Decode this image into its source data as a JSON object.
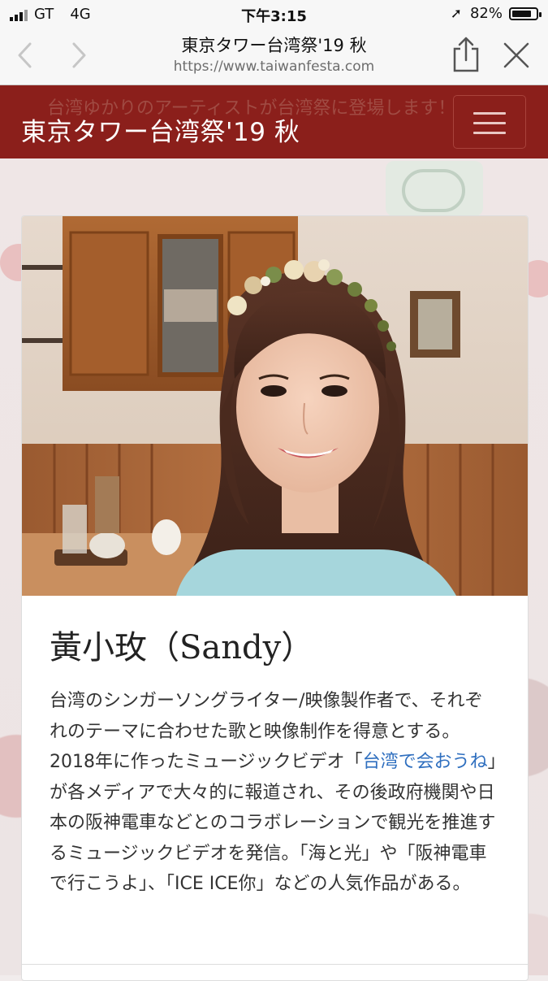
{
  "status_bar": {
    "carrier": "GT",
    "network": "4G",
    "time": "下午3:15",
    "battery": "82%",
    "battery_level": 0.82
  },
  "browser": {
    "page_title": "東京タワー台湾祭'19 秋",
    "url": "https://www.taiwanfesta.com",
    "back_icon": "chevron-left-icon",
    "forward_icon": "chevron-right-icon",
    "share_icon": "share-icon",
    "close_icon": "close-icon"
  },
  "header": {
    "ghost_text": "台湾ゆかりのアーティストが台湾祭に登場します！",
    "brand": "東京タワー台湾祭'19 秋",
    "menu_icon": "hamburger-menu-icon",
    "color": "#8b1f1b"
  },
  "artist": {
    "name": "黃小玫（Sandy）",
    "bio_part1": "台湾のシンガーソングライター/映像製作者で、それぞれのテーマに合わせた歌と映像制作を得意とする。2018年に作ったミュージックビデオ「",
    "bio_link": "台湾で会おうね",
    "bio_part2": "」が各メディアで大々的に報道され、その後政府機関や日本の阪神電車などとのコラボレーションで観光を推進するミュージックビデオを発信。「海と光」や「阪神電車で行こうよ」、「ICE ICE你」などの人気作品がある。",
    "link_color": "#2f6fbf"
  }
}
